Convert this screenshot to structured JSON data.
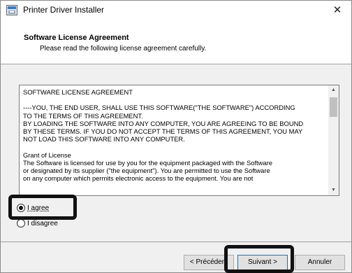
{
  "window": {
    "title": "Printer Driver Installer",
    "close_glyph": "✕",
    "icon": "installer-icon"
  },
  "header": {
    "title": "Software License Agreement",
    "subtitle": "Please read the following license agreement carefully."
  },
  "license": {
    "text": "SOFTWARE LICENSE AGREEMENT\n\n----YOU, THE END USER, SHALL USE THIS SOFTWARE(\"THE SOFTWARE\") ACCORDING\nTO THE TERMS OF THIS AGREEMENT.\nBY LOADING THE SOFTWARE INTO ANY COMPUTER, YOU ARE AGREEING TO BE BOUND\nBY THESE TERMS. IF YOU DO NOT ACCEPT THE TERMS OF THIS AGREEMENT, YOU MAY\nNOT LOAD THIS SOFTWARE INTO ANY COMPUTER.\n\nGrant of License\nThe Software is licensed for use by you for the equipment packaged with the Software\nor designated by its supplier (\"the equipment\"). You are permitted to use the Software\non any computer which permits electronic access to the equipment. You are not"
  },
  "options": {
    "agree_label": "I agree",
    "disagree_label": "I disagree",
    "selected": "agree"
  },
  "buttons": {
    "back_label": "< Précédent",
    "next_label": "Suivant >",
    "cancel_label": "Annuler"
  }
}
